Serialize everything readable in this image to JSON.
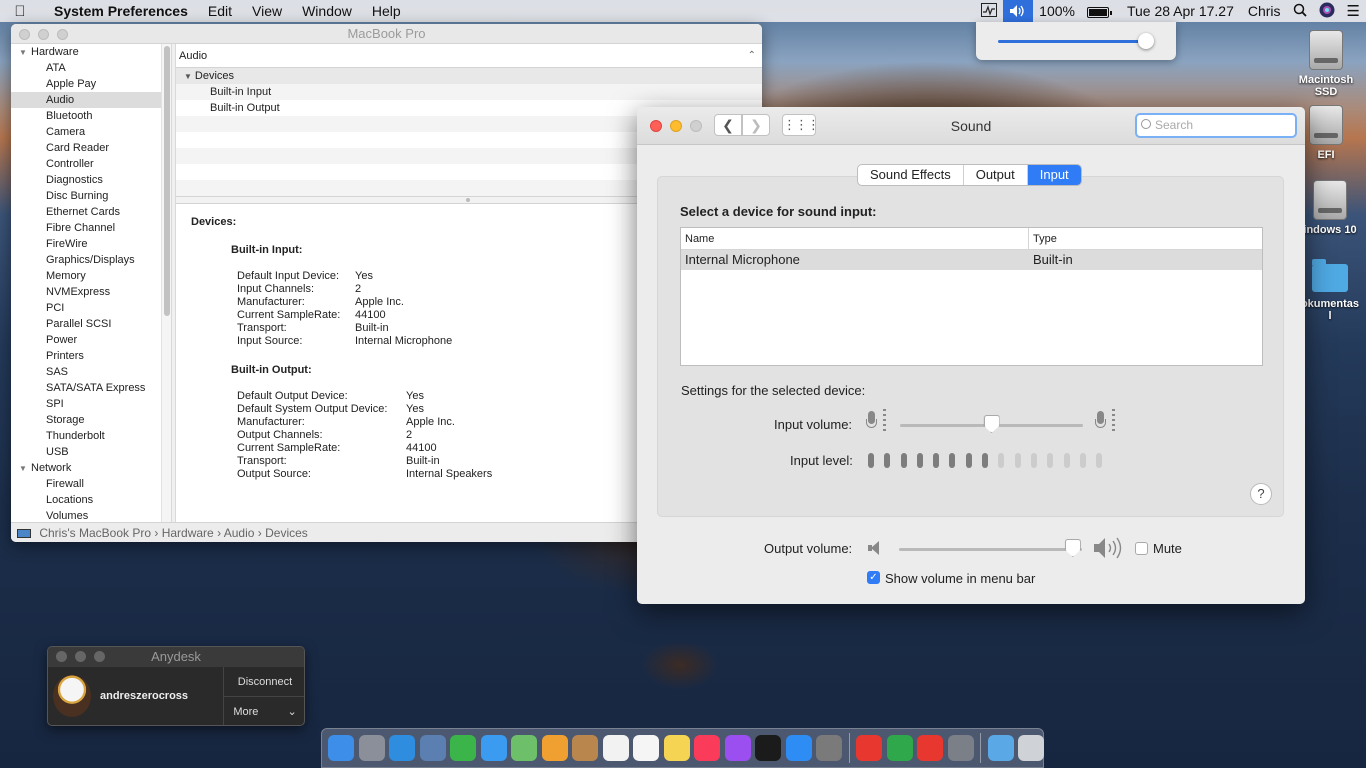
{
  "menubar": {
    "app_name": "System Preferences",
    "menus": [
      "Edit",
      "View",
      "Window",
      "Help"
    ],
    "battery": "100%",
    "datetime": "Tue 28 Apr  17.27",
    "user": "Chris"
  },
  "volume_popup": {
    "level": 0.95
  },
  "desktop": {
    "icons": [
      "Macintosh SSD",
      "EFI",
      "indows 10",
      "okumentas l"
    ]
  },
  "sysinfo": {
    "title": "MacBook Pro",
    "sidebar": {
      "hardware_label": "Hardware",
      "hardware_items": [
        "ATA",
        "Apple Pay",
        "Audio",
        "Bluetooth",
        "Camera",
        "Card Reader",
        "Controller",
        "Diagnostics",
        "Disc Burning",
        "Ethernet Cards",
        "Fibre Channel",
        "FireWire",
        "Graphics/Displays",
        "Memory",
        "NVMExpress",
        "PCI",
        "Parallel SCSI",
        "Power",
        "Printers",
        "SAS",
        "SATA/SATA Express",
        "SPI",
        "Storage",
        "Thunderbolt",
        "USB"
      ],
      "network_label": "Network",
      "network_items": [
        "Firewall",
        "Locations",
        "Volumes"
      ],
      "selected": "Audio"
    },
    "content_header": "Audio",
    "tree": {
      "group": "Devices",
      "items": [
        "Built-in Input",
        "Built-in Output"
      ]
    },
    "detail": {
      "heading": "Devices:",
      "input_title": "Built-in Input:",
      "input_kv": [
        [
          "Default Input Device:",
          "Yes"
        ],
        [
          "Input Channels:",
          "2"
        ],
        [
          "Manufacturer:",
          "Apple Inc."
        ],
        [
          "Current SampleRate:",
          "44100"
        ],
        [
          "Transport:",
          "Built-in"
        ],
        [
          "Input Source:",
          "Internal Microphone"
        ]
      ],
      "output_title": "Built-in Output:",
      "output_kv": [
        [
          "Default Output Device:",
          "Yes"
        ],
        [
          "Default System Output Device:",
          "Yes"
        ],
        [
          "Manufacturer:",
          "Apple Inc."
        ],
        [
          "Output Channels:",
          "2"
        ],
        [
          "Current SampleRate:",
          "44100"
        ],
        [
          "Transport:",
          "Built-in"
        ],
        [
          "Output Source:",
          "Internal Speakers"
        ]
      ]
    },
    "breadcrumb": [
      "Chris's MacBook Pro",
      "Hardware",
      "Audio",
      "Devices"
    ]
  },
  "sound": {
    "title": "Sound",
    "search_placeholder": "Search",
    "tabs": [
      "Sound Effects",
      "Output",
      "Input"
    ],
    "active_tab": "Input",
    "select_label": "Select a device for sound input:",
    "table": {
      "columns": [
        "Name",
        "Type"
      ],
      "rows": [
        [
          "Internal Microphone",
          "Built-in"
        ]
      ]
    },
    "settings_label": "Settings for the selected device:",
    "input_volume_label": "Input volume:",
    "input_volume": 0.5,
    "input_level_label": "Input level:",
    "input_level_on": 8,
    "input_level_total": 15,
    "output_volume_label": "Output volume:",
    "output_volume": 0.95,
    "mute_label": "Mute",
    "mute_checked": false,
    "show_volume_label": "Show volume in menu bar",
    "show_volume_checked": true,
    "help": "?"
  },
  "anydesk": {
    "title": "Anydesk",
    "user": "andreszerocross",
    "disconnect": "Disconnect",
    "more": "More"
  },
  "dock": {
    "apps": [
      {
        "name": "finder",
        "color": "#3d8ee8"
      },
      {
        "name": "launchpad",
        "color": "#8a8f99"
      },
      {
        "name": "safari",
        "color": "#2f8de0"
      },
      {
        "name": "preview",
        "color": "#5a7fb0"
      },
      {
        "name": "facetime",
        "color": "#3bb54a"
      },
      {
        "name": "messages",
        "color": "#3a9bf0"
      },
      {
        "name": "maps",
        "color": "#6dbf6a"
      },
      {
        "name": "photos",
        "color": "#f0a030"
      },
      {
        "name": "notefile",
        "color": "#b9874d"
      },
      {
        "name": "calendar",
        "color": "#f2f2f2"
      },
      {
        "name": "reminders",
        "color": "#f5f5f5"
      },
      {
        "name": "notes",
        "color": "#f5d453"
      },
      {
        "name": "music",
        "color": "#fa3c5a"
      },
      {
        "name": "podcasts",
        "color": "#9b4ff0"
      },
      {
        "name": "tv",
        "color": "#1b1b1b"
      },
      {
        "name": "app-store",
        "color": "#2e8df5"
      },
      {
        "name": "system-preferences",
        "color": "#7a7a7a"
      },
      {
        "name": "anydesk",
        "color": "#e8372f"
      },
      {
        "name": "remote-app",
        "color": "#2ea84a"
      },
      {
        "name": "anydesk-2",
        "color": "#e8372f"
      },
      {
        "name": "utility",
        "color": "#7a7f88"
      },
      {
        "name": "downloads",
        "color": "#5aa9e6"
      },
      {
        "name": "trash",
        "color": "#cfd3d8"
      }
    ]
  }
}
